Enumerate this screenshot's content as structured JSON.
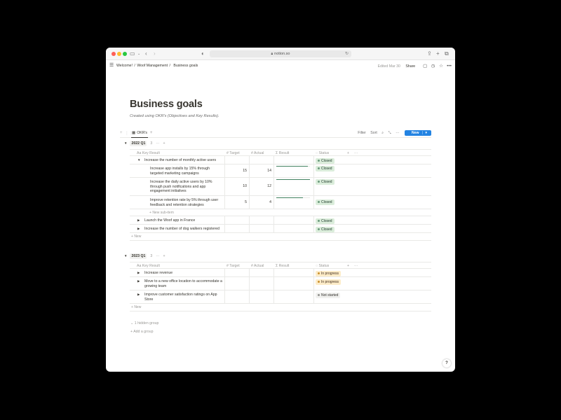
{
  "browser": {
    "url": "notion.so",
    "icons": [
      "sidebar-icon",
      "back-icon",
      "forward-icon",
      "shield-icon",
      "lock-icon",
      "reload-icon",
      "share-icon",
      "add-tab-icon",
      "tabs-icon"
    ]
  },
  "topbar": {
    "breadcrumbs": [
      "Welcome!",
      "/",
      "Woof Management",
      "/",
      "Business goals"
    ],
    "edited": "Edited Mar 30",
    "share_label": "Share"
  },
  "page": {
    "title": "Business goals",
    "subtitle": "Created using OKR's (Objectives and Key Results)."
  },
  "view": {
    "tab_label": "OKR's",
    "filter_label": "Filter",
    "sort_label": "Sort",
    "new_label": "New"
  },
  "columns": {
    "key_result": "Key Result",
    "target": "Target",
    "actual": "Actual",
    "result": "Result",
    "status": "Status"
  },
  "groups": [
    {
      "name": "2022 Q1",
      "count": "3",
      "rows": [
        {
          "name": "Increase the number of monthly active users",
          "expanded": true,
          "status": "Closed",
          "status_kind": "closed"
        },
        {
          "name": "Increase app installs by 15% through targeted marketing campaigns",
          "target": "15",
          "actual": "14",
          "progress": 0.93,
          "status": "Closed",
          "status_kind": "closed",
          "sub": true
        },
        {
          "name": "Increase the daily active users by 10% through push notifications and app engagement initiatives",
          "target": "10",
          "actual": "12",
          "progress": 1.0,
          "status": "Closed",
          "status_kind": "closed",
          "sub": true
        },
        {
          "name": "Improve retention rate by 5% through user feedback and retention strategies",
          "target": "5",
          "actual": "4",
          "progress": 0.8,
          "status": "Closed",
          "status_kind": "closed",
          "sub": true
        },
        {
          "name": "Launch the Woof app in France",
          "status": "Closed",
          "status_kind": "closed"
        },
        {
          "name": "Increase the number of dog walkers registered",
          "status": "Closed",
          "status_kind": "closed"
        }
      ],
      "new_sub_item": "New sub-item",
      "new_label": "New"
    },
    {
      "name": "2023 Q1",
      "count": "3",
      "rows": [
        {
          "name": "Increase revenue",
          "status": "In progress",
          "status_kind": "progress"
        },
        {
          "name": "Move to a new office location to accommodate a growing team",
          "status": "In progress",
          "status_kind": "progress"
        },
        {
          "name": "Improve customer satisfaction ratings on App Store",
          "status": "Not started",
          "status_kind": "notstarted"
        }
      ],
      "new_label": "New"
    }
  ],
  "footer": {
    "hidden_group": "1 hidden group",
    "add_group": "Add a group"
  },
  "help_label": "?",
  "colors": {
    "accent": "#2383e2",
    "closed_bg": "#dbeddb",
    "progress_bg": "#fdecc8",
    "notstarted_bg": "#f1f1ef",
    "bar_fill": "#448361"
  }
}
